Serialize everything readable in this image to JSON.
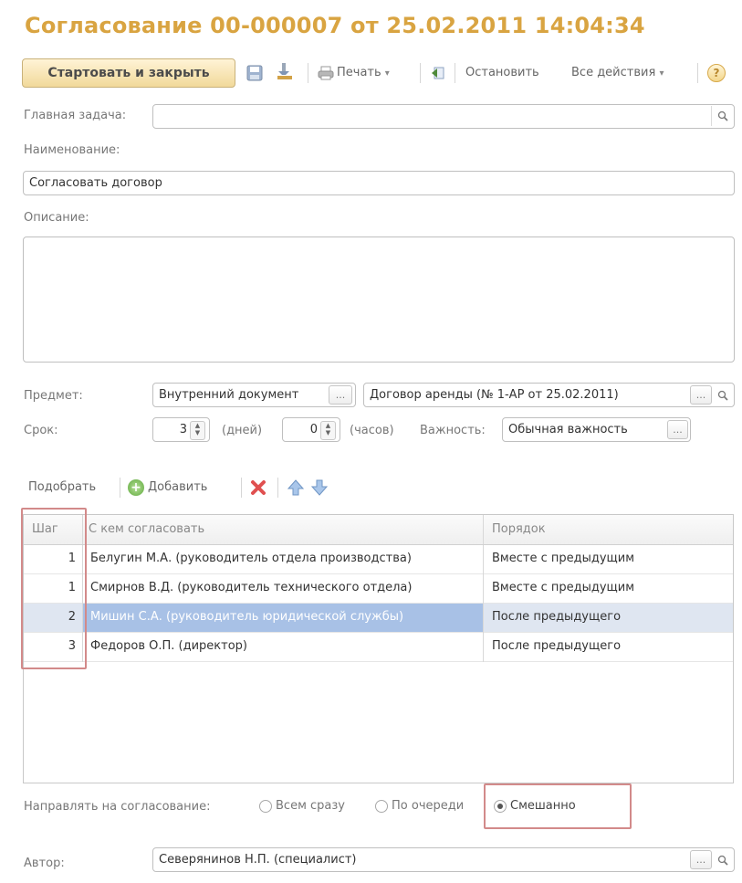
{
  "title": "Согласование 00-000007 от 25.02.2011 14:04:34",
  "toolbar": {
    "start_close": "Стартовать и закрыть",
    "print": "Печать",
    "stop": "Остановить",
    "all_actions": "Все действия",
    "help": "?"
  },
  "main_task": {
    "label": "Главная задача:",
    "value": ""
  },
  "name": {
    "label": "Наименование:",
    "value": "Согласовать договор"
  },
  "description": {
    "label": "Описание:",
    "value": ""
  },
  "subject": {
    "label": "Предмет:",
    "type_value": "Внутренний документ",
    "doc_value": "Договор аренды (№ 1-АР от 25.02.2011)"
  },
  "deadline": {
    "label": "Срок:",
    "days_value": "3",
    "days_unit": "(дней)",
    "hours_value": "0",
    "hours_unit": "(часов)",
    "importance_label": "Важность:",
    "importance_value": "Обычная важность"
  },
  "table_toolbar": {
    "pick": "Подобрать",
    "add": "Добавить"
  },
  "table": {
    "headers": {
      "step": "Шаг",
      "who": "С кем согласовать",
      "order": "Порядок"
    },
    "rows": [
      {
        "step": "1",
        "who": "Белугин М.А. (руководитель отдела производства)",
        "order": "Вместе с предыдущим"
      },
      {
        "step": "1",
        "who": "Смирнов В.Д. (руководитель технического отдела)",
        "order": "Вместе с предыдущим"
      },
      {
        "step": "2",
        "who": "Мишин С.А. (руководитель юридической службы)",
        "order": "После предыдущего"
      },
      {
        "step": "3",
        "who": "Федоров О.П. (директор)",
        "order": "После предыдущего"
      }
    ]
  },
  "routing": {
    "label": "Направлять на согласование:",
    "options": [
      "Всем сразу",
      "По очереди",
      "Смешанно"
    ],
    "selected": "Смешанно"
  },
  "author": {
    "label": "Автор:",
    "value": "Северянинов Н.П. (специалист)"
  },
  "colors": {
    "title": "#d9a441",
    "selection": "#a8c1e6",
    "highlight": "#d28a8a"
  }
}
